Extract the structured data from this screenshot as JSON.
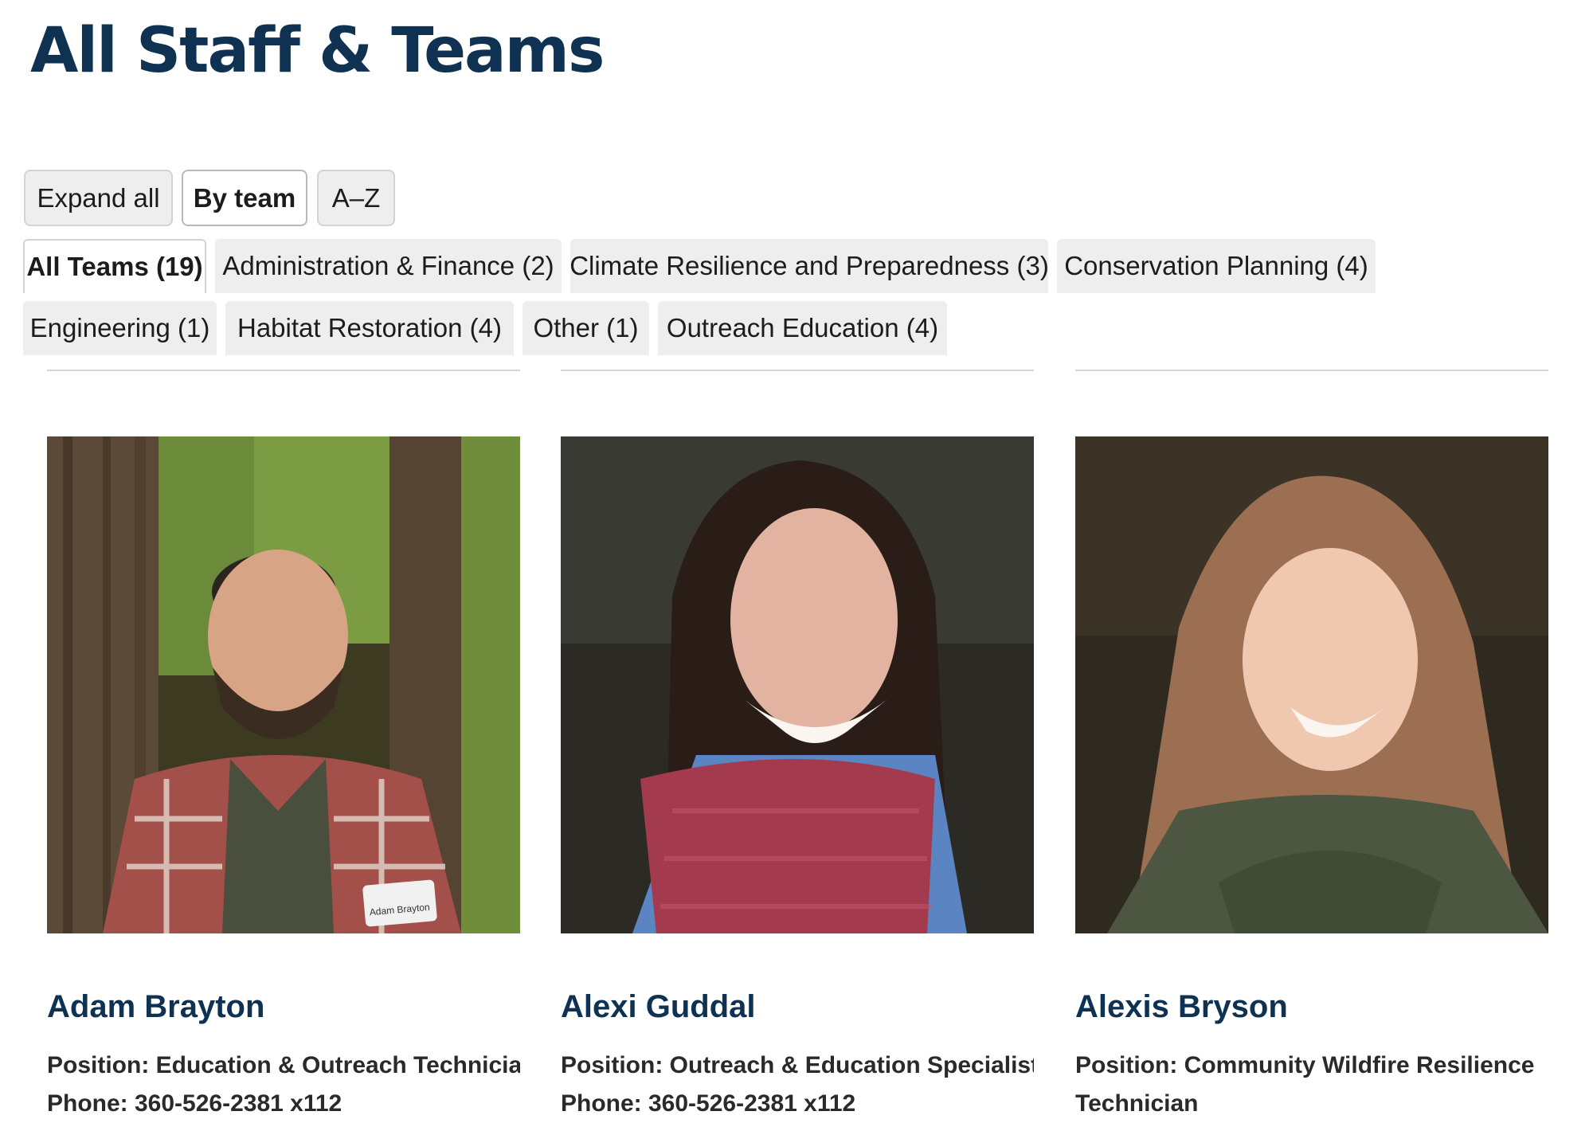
{
  "page": {
    "title": "All Staff & Teams"
  },
  "view_controls": [
    {
      "label": "Expand all",
      "active": false
    },
    {
      "label": "By team",
      "active": true
    },
    {
      "label": "A–Z",
      "active": false
    }
  ],
  "team_tabs": [
    {
      "label": "All Teams (19)",
      "active": true
    },
    {
      "label": "Administration & Finance (2)",
      "active": false
    },
    {
      "label": "Climate Resilience and Preparedness (3)",
      "active": false
    },
    {
      "label": "Conservation Planning (4)",
      "active": false
    },
    {
      "label": "Engineering (1)",
      "active": false
    },
    {
      "label": "Habitat Restoration (4)",
      "active": false
    },
    {
      "label": "Other (1)",
      "active": false
    },
    {
      "label": "Outreach Education (4)",
      "active": false
    }
  ],
  "staff": [
    {
      "name": "Adam Brayton",
      "position": "Position: Education & Outreach Technician",
      "phone": "Phone: 360-526-2381 x112",
      "badge": "Adam Brayton"
    },
    {
      "name": "Alexi Guddal",
      "position": "Position: Outreach & Education Specialist",
      "phone": "Phone: 360-526-2381 x112"
    },
    {
      "name": "Alexis Bryson",
      "position": "Position: Community Wildfire Resilience Technician"
    }
  ],
  "colors": {
    "heading": "#0f3152",
    "button_bg": "#eeeeee",
    "border": "#d3d3d3"
  }
}
